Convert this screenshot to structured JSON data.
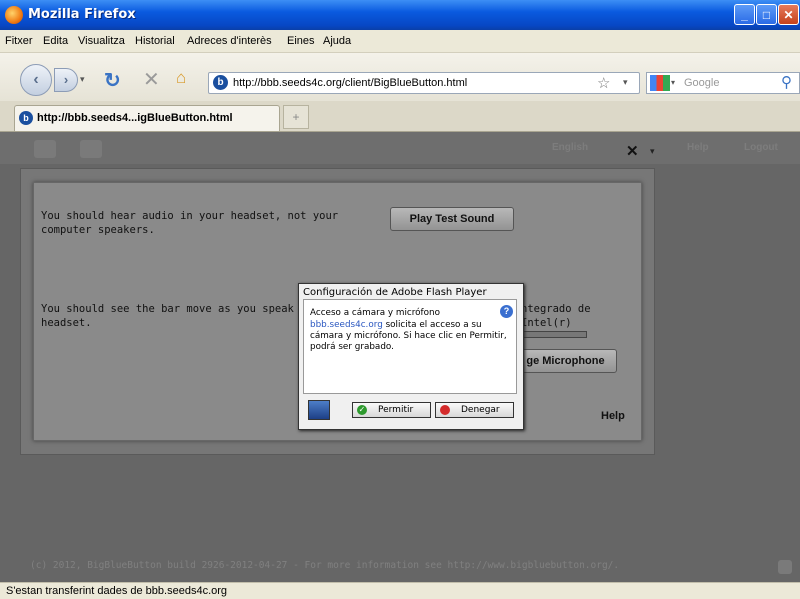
{
  "window": {
    "title": "Mozilla Firefox"
  },
  "menu": [
    "Fitxer",
    "Edita",
    "Visualitza",
    "Historial",
    "Adreces d'interès",
    "Eines",
    "Ajuda"
  ],
  "nav": {
    "url": "http://bbb.seeds4c.org/client/BigBlueButton.html",
    "search_placeholder": "Google"
  },
  "tab": {
    "title": "http://bbb.seeds4...igBlueButton.html",
    "new_tab": "+"
  },
  "app": {
    "language": "English",
    "help": "Help",
    "logout": "Logout",
    "close_glyph": "✕",
    "footer": "(c) 2012, BigBlueButton build 2926-2012-04-27 - For more information see http://www.bigbluebutton.org/."
  },
  "dialog": {
    "audio_text": "You should hear audio in your headset, not your computer speakers.",
    "play_test_sound": "Play Test Sound",
    "bar_text": "You should see the bar move as you speak",
    "headset": "headset.",
    "mic_text_tail": "ntegrado de Intel(r)",
    "change_mic": "ge Microphone",
    "help": "Help"
  },
  "flash": {
    "title": "Configuración de Adobe Flash Player",
    "heading": "Acceso a cámara y micrófono",
    "domain": "bbb.seeds4c.org",
    "message": "solicita el acceso a su cámara y micrófono. Si hace clic en Permitir, podrá ser grabado.",
    "allow": "Permitir",
    "deny": "Denegar"
  },
  "status": {
    "text": "S'estan transferint dades de bbb.seeds4c.org"
  }
}
